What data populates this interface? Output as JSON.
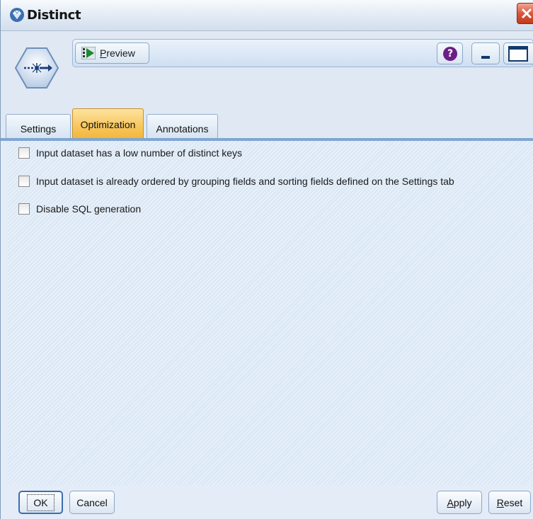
{
  "window": {
    "title": "Distinct"
  },
  "toolbar": {
    "preview_label_prefix": "",
    "preview_label_mnemonic": "P",
    "preview_label_rest": "review",
    "help_glyph": "?"
  },
  "tabs": [
    {
      "label": "Settings",
      "active": false
    },
    {
      "label": "Optimization",
      "active": true
    },
    {
      "label": "Annotations",
      "active": false
    }
  ],
  "options": [
    {
      "label": "Input dataset has a low number of distinct keys",
      "checked": false
    },
    {
      "label": "Input dataset is already ordered by grouping fields and sorting fields defined on the Settings tab",
      "checked": false
    },
    {
      "label": "Disable SQL generation",
      "checked": false
    }
  ],
  "buttons": {
    "ok": "OK",
    "cancel": "Cancel",
    "apply_mnemonic": "A",
    "apply_rest": "pply",
    "reset_mnemonic": "R",
    "reset_rest": "eset"
  },
  "icons": {
    "title": "diamond-gem-icon",
    "node": "distinct-node-icon",
    "preview": "preview-play-icon",
    "help": "help-icon",
    "minimize": "minimize-icon",
    "maximize": "maximize-icon",
    "close": "close-icon"
  },
  "colors": {
    "active_tab": "#f7c55a",
    "close_button": "#d9573a",
    "help_icon": "#6a1f86",
    "content_bg": "#dce8f6"
  }
}
